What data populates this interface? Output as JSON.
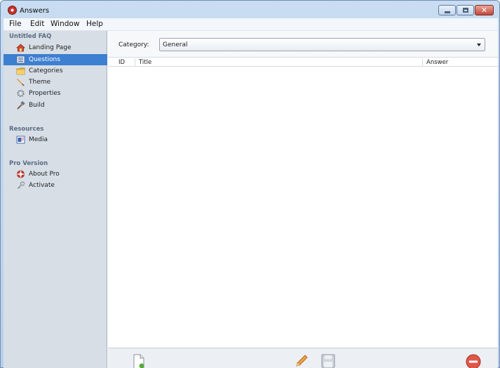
{
  "window": {
    "title": "Answers",
    "app_icon": "lifebuoy-icon"
  },
  "window_controls": [
    "minimize",
    "maximize",
    "close"
  ],
  "menu": [
    "File",
    "Edit",
    "Window",
    "Help"
  ],
  "sidebar": {
    "groups": [
      {
        "label": "Untitled FAQ",
        "items": [
          {
            "label": "Landing Page",
            "icon": "home-icon",
            "selected": false
          },
          {
            "label": "Questions",
            "icon": "list-icon",
            "selected": true
          },
          {
            "label": "Categories",
            "icon": "folder-icon",
            "selected": false
          },
          {
            "label": "Theme",
            "icon": "brush-icon",
            "selected": false
          },
          {
            "label": "Properties",
            "icon": "gear-icon",
            "selected": false
          },
          {
            "label": "Build",
            "icon": "hammer-icon",
            "selected": false
          }
        ]
      },
      {
        "label": "Resources",
        "items": [
          {
            "label": "Media",
            "icon": "media-icon",
            "selected": false
          }
        ]
      },
      {
        "label": "Pro Version",
        "items": [
          {
            "label": "About Pro",
            "icon": "lifebuoy-icon",
            "selected": false
          },
          {
            "label": "Activate",
            "icon": "key-icon",
            "selected": false
          }
        ]
      }
    ]
  },
  "category": {
    "label": "Category:",
    "selected": "General"
  },
  "table": {
    "columns": [
      "ID",
      "Title",
      "Answer"
    ],
    "rows": []
  },
  "toolbar": {
    "buttons": [
      "new-document-icon",
      "edit-pencil-icon",
      "save-disk-icon",
      "delete-icon"
    ]
  },
  "colors": {
    "selection": "#3d7fd0",
    "sidebar_bg": "#d7dee6",
    "titlebar": "#c9dcf1",
    "close_button": "#c4473a"
  }
}
